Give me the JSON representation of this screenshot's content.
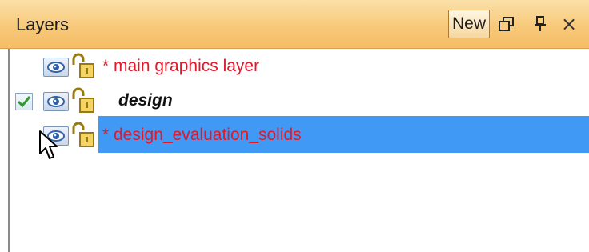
{
  "panel": {
    "title": "Layers",
    "new_label": "New",
    "icons": [
      "restore-window-icon",
      "pin-icon",
      "close-icon"
    ]
  },
  "layers": [
    {
      "name": "* main graphics layer",
      "visible": true,
      "unlocked": true,
      "checked": false,
      "selected": false,
      "modified": true
    },
    {
      "name": "design",
      "visible": true,
      "unlocked": true,
      "checked": true,
      "selected": false,
      "modified": false
    },
    {
      "name": "* design_evaluation_solids",
      "visible": true,
      "unlocked": true,
      "checked": false,
      "selected": true,
      "modified": true
    }
  ],
  "colors": {
    "header_gradient_top": "#fbe0a8",
    "header_gradient_bottom": "#f5bd66",
    "selection": "#3f99f5",
    "modified_text": "#e0192a",
    "check": "#2e9b2e"
  }
}
